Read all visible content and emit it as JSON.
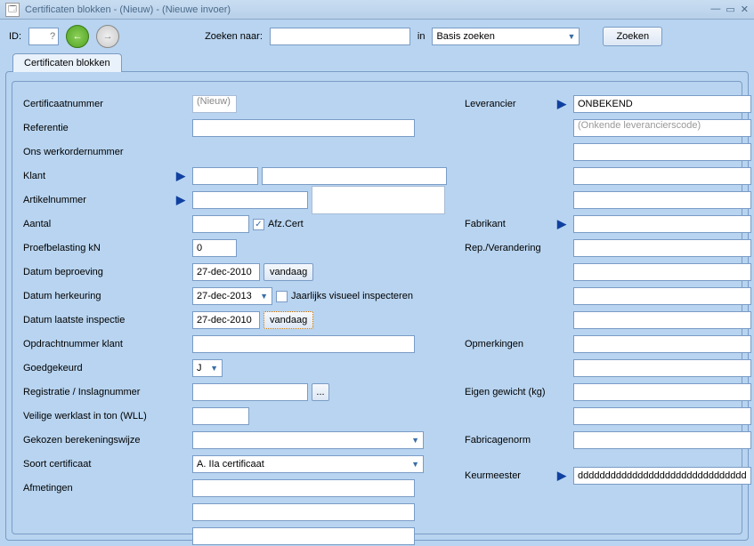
{
  "window": {
    "title": "Certificaten blokken - (Nieuw) - (Nieuwe invoer)"
  },
  "toolbar": {
    "id_label": "ID:",
    "id_value": "",
    "id_placeholder": "?",
    "search_label": "Zoeken naar:",
    "search_value": "",
    "in_label": "in",
    "search_scope": "Basis zoeken",
    "search_button": "Zoeken"
  },
  "tabs": {
    "active": "Certificaten blokken"
  },
  "left": {
    "certificaatnummer_label": "Certificaatnummer",
    "certificaatnummer_value": "(Nieuw)",
    "referentie_label": "Referentie",
    "referentie_value": "",
    "werkordernummer_label": "Ons werkordernummer",
    "klant_label": "Klant",
    "klant_code": "",
    "klant_naam": "",
    "artikelnummer_label": "Artikelnummer",
    "artikelnummer_code": "",
    "artikelnummer_desc": "",
    "aantal_label": "Aantal",
    "aantal_value": "",
    "afz_label": "Afz.Cert",
    "proefbelasting_label": "Proefbelasting kN",
    "proefbelasting_value": "0",
    "datum_beproeving_label": "Datum beproeving",
    "datum_beproeving_value": "27-dec-2010",
    "vandaag_btn": "vandaag",
    "datum_herkeuring_label": "Datum herkeuring",
    "datum_herkeuring_value": "27-dec-2013",
    "jaarlijks_label": "Jaarlijks visueel inspecteren",
    "datum_inspectie_label": "Datum laatste inspectie",
    "datum_inspectie_value": "27-dec-2010",
    "opdrachtnummer_label": "Opdrachtnummer klant",
    "opdrachtnummer_value": "",
    "goedgekeurd_label": "Goedgekeurd",
    "goedgekeurd_value": "J",
    "registratie_label": "Registratie / Inslagnummer",
    "registratie_value": "",
    "wll_label": "Veilige werklast in ton (WLL)",
    "wll_value": "",
    "berekeningswijze_label": "Gekozen berekeningswijze",
    "berekeningswijze_value": "",
    "soort_label": "Soort certificaat",
    "soort_value": "A. IIa certificaat",
    "afmetingen_label": "Afmetingen",
    "afmetingen_value": "",
    "dots": "..."
  },
  "right": {
    "leverancier_label": "Leverancier",
    "leverancier_value": "ONBEKEND",
    "leverancier_code_placeholder": "(Onkende leverancierscode)",
    "fabrikant_label": "Fabrikant",
    "fabrikant_value": "",
    "rep_label": "Rep./Verandering",
    "rep_value": "",
    "opmerkingen_label": "Opmerkingen",
    "eigen_gewicht_label": "Eigen gewicht (kg)",
    "eigen_gewicht_value": "",
    "fabricagenorm_label": "Fabricagenorm",
    "fabricagenorm_value": "",
    "keurmeester_label": "Keurmeester",
    "keurmeester_value": "ddddddddddddddddddddddddddddddddc"
  }
}
